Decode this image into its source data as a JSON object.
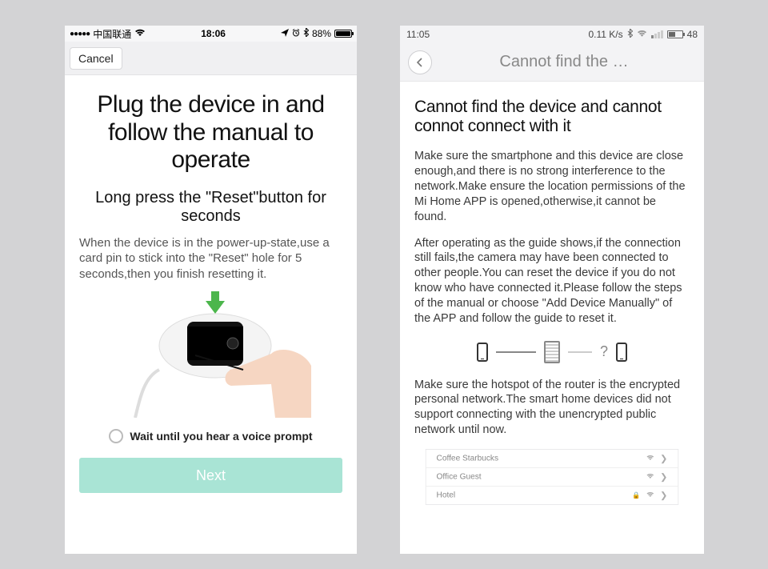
{
  "left": {
    "statusbar": {
      "carrier": "中国联通",
      "time": "18:06",
      "battery_pct": "88%",
      "battery_fill_pct": 88
    },
    "nav": {
      "cancel": "Cancel"
    },
    "title": "Plug the device in and follow the manual to operate",
    "subtitle": "Long press the \"Reset\"button for seconds",
    "body": "When the device is in the power-up-state,use a card pin to stick into the \"Reset\" hole for 5 seconds,then you finish resetting it.",
    "checkbox_label": "Wait until you hear a voice prompt",
    "next": "Next"
  },
  "right": {
    "statusbar": {
      "time": "11:05",
      "net_speed": "0.11 K/s",
      "battery_pct": "48",
      "battery_fill_pct": 48
    },
    "nav": {
      "title": "Cannot find the …"
    },
    "title": "Cannot find the device and cannot connot connect with it",
    "para1": "Make sure the smartphone and this device are close enough,and there is no strong interference to the network.Make ensure the location permissions of the Mi Home APP is opened,otherwise,it cannot be found.",
    "para2": "After operating as the guide shows,if the connection still fails,the camera may have been connected to other people.You can reset the device if you do not know who have connected it.Please follow the steps of the manual or choose \"Add Device Manually\" of the APP and follow the guide to reset it.",
    "para3": "Make sure the hotspot of the router is the encrypted personal network.The smart home devices did not support connecting with the unencrypted public network until now.",
    "diagram_q": "?",
    "wifi": [
      {
        "name": "Coffee Starbucks",
        "locked": false
      },
      {
        "name": "Office Guest",
        "locked": false
      },
      {
        "name": "Hotel",
        "locked": true
      }
    ]
  }
}
